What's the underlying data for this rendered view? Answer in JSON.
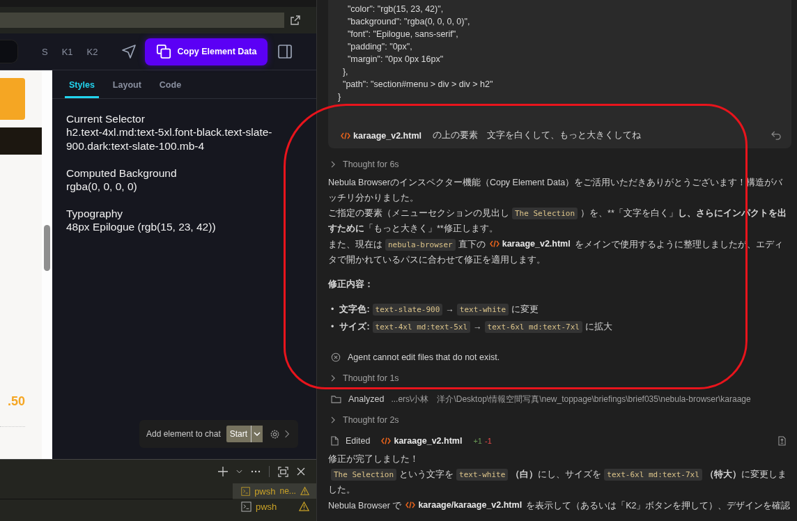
{
  "browser": {
    "toolbar": {
      "view_buttons": [
        {
          "label": "S"
        },
        {
          "label": "K1"
        },
        {
          "label": "K2"
        }
      ],
      "copy_button": "Copy Element Data"
    },
    "preview": {
      "price": ".50"
    },
    "inspector": {
      "tabs": [
        {
          "label": "Styles",
          "selected": true
        },
        {
          "label": "Layout",
          "selected": false
        },
        {
          "label": "Code",
          "selected": false
        }
      ],
      "sections": [
        {
          "title": "Current Selector",
          "value": "h2.text-4xl.md:text-5xl.font-black.text-slate-900.dark:text-slate-100.mb-4"
        },
        {
          "title": "Computed Background",
          "value": "rgba(0, 0, 0, 0)"
        },
        {
          "title": "Typography",
          "value": "48px Epilogue (rgb(15, 23, 42))"
        }
      ],
      "chat_bar": {
        "label": "Add element to chat",
        "button": "Start"
      }
    }
  },
  "terminal": {
    "sessions": [
      {
        "name": "pwsh",
        "detail": "ne...",
        "selected": true,
        "warning": true
      },
      {
        "name": "pwsh",
        "selected": false,
        "warning": true
      }
    ]
  },
  "chat": {
    "code_lines": [
      "    \"color\": \"rgb(15, 23, 42)\",",
      "    \"background\": \"rgba(0, 0, 0, 0)\",",
      "    \"font\": \"Epilogue, sans-serif\",",
      "    \"padding\": \"0px\",",
      "    \"margin\": \"0px 0px 16px\"",
      "  },",
      "  \"path\": \"section#menu > div > div > h2\"",
      "}"
    ],
    "user_message": {
      "file": "karaage_v2.html",
      "text": "の上の要素　文字を白くして、もっと大きくしてね"
    },
    "items": [
      {
        "kind": "thought",
        "label": "Thought for 6s"
      },
      {
        "kind": "paragraph",
        "lines": [
          [
            {
              "kind": "text",
              "text": "Nebula Browserのインスペクター機能（Copy Element Data）をご活用いただきありがとうございます！構造がバッチリ分かりました。"
            }
          ],
          [
            {
              "kind": "text",
              "text": "ご指定の要素（メニューセクションの見出し"
            },
            {
              "kind": "code",
              "text": "The Selection"
            },
            {
              "kind": "text",
              "text": "）を、**「文字を白く」"
            },
            {
              "kind": "bold",
              "text": "し、さらにインパクトを出すために"
            },
            {
              "kind": "text",
              "text": "「もっと大きく」**修正します。"
            }
          ],
          [
            {
              "kind": "text",
              "text": "また、現在は"
            },
            {
              "kind": "code",
              "text": "nebula-browser"
            },
            {
              "kind": "text",
              "text": "直下の"
            },
            {
              "kind": "file",
              "text": "karaage_v2.html"
            },
            {
              "kind": "text",
              "text": "をメインで使用するように整理しましたが、エディタで開かれているパスに合わせて修正を適用します。"
            }
          ]
        ]
      },
      {
        "kind": "heading",
        "text": "修正内容："
      },
      {
        "kind": "bullets",
        "items": [
          {
            "marker": "•",
            "label": "文字色:",
            "segments": [
              {
                "kind": "code",
                "text": "text-slate-900"
              },
              {
                "kind": "text",
                "text": "→"
              },
              {
                "kind": "code",
                "text": "text-white"
              },
              {
                "kind": "text",
                "text": "に変更"
              }
            ]
          },
          {
            "marker": "•",
            "label": "サイズ:",
            "segments": [
              {
                "kind": "code",
                "text": "text-4xl md:text-5xl"
              },
              {
                "kind": "text",
                "text": "→"
              },
              {
                "kind": "code",
                "text": "text-6xl md:text-7xl"
              },
              {
                "kind": "text",
                "text": "に拡大"
              }
            ]
          }
        ]
      },
      {
        "kind": "error",
        "text": "Agent cannot edit files that do not exist."
      },
      {
        "kind": "thought",
        "label": "Thought for 1s"
      },
      {
        "kind": "analyzed",
        "label": "Analyzed",
        "path": "...ers\\小林　洋介\\Desktop\\情報空間写真\\new_toppage\\briefings\\brief035\\nebula-browser\\karaage"
      },
      {
        "kind": "thought",
        "label": "Thought for 2s"
      },
      {
        "kind": "edited",
        "label": "Edited",
        "file": "karaage_v2.html",
        "added": "+1",
        "removed": "-1"
      },
      {
        "kind": "paragraph",
        "lines": [
          [
            {
              "kind": "text",
              "text": "修正が完了しました！"
            }
          ],
          [
            {
              "kind": "code",
              "text": "The Selection"
            },
            {
              "kind": "text",
              "text": "という文字を"
            },
            {
              "kind": "code",
              "text": "text-white"
            },
            {
              "kind": "bold",
              "text": "（白）"
            },
            {
              "kind": "text",
              "text": "にし、サイズを"
            },
            {
              "kind": "code",
              "text": "text-6xl md:text-7xl"
            },
            {
              "kind": "bold",
              "text": "（特大）"
            },
            {
              "kind": "text",
              "text": "に変更しました。"
            }
          ],
          [
            {
              "kind": "text",
              "text": "Nebula Browser で"
            },
            {
              "kind": "file",
              "text": "karaage/karaage_v2.html"
            },
            {
              "kind": "text",
              "text": "を表示して（あるいは「K2」ボタンを押して）、デザインを確認"
            }
          ]
        ]
      }
    ]
  }
}
